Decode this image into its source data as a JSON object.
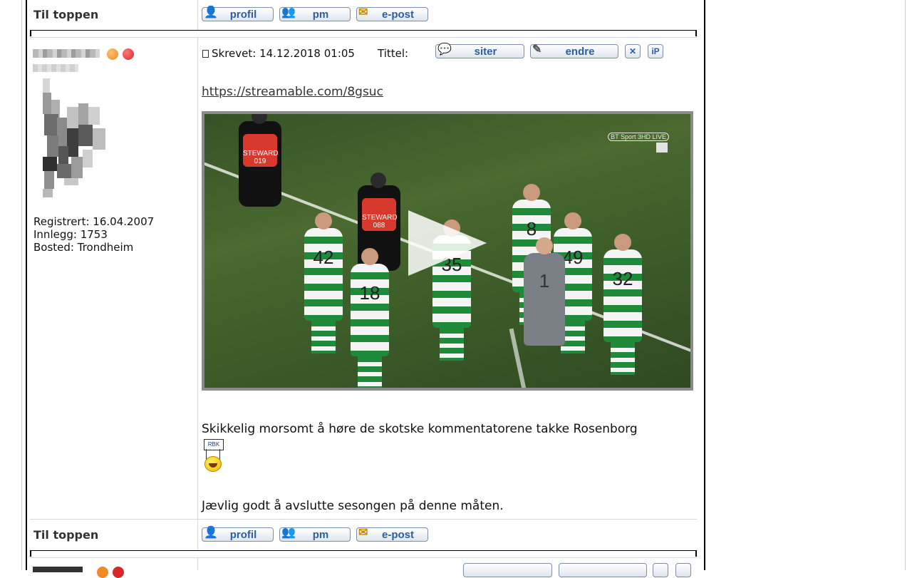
{
  "top_row": {
    "til_toppen": "Til toppen",
    "buttons": {
      "profil": "profil",
      "pm": "pm",
      "epost": "e-post"
    }
  },
  "post": {
    "author": {
      "registrert": "Registrert: 16.04.2007",
      "innlegg": "Innlegg: 1753",
      "bosted": "Bosted: Trondheim",
      "status_colors": [
        "#f08a24",
        "#d8262c"
      ]
    },
    "header": {
      "skrevet": "Skrevet: 14.12.2018 01:05",
      "tittel": "Tittel:",
      "buttons": {
        "siter": "siter",
        "endre": "endre",
        "delete": "✕",
        "ip": "iP"
      }
    },
    "link": "https://streamable.com/8gsuc",
    "video": {
      "overlay_brand": "BT Sport 3HD LIVE",
      "vest_text_1": "STEWARD 019",
      "vest_text_2": "STEWARD 088",
      "shirt_numbers": [
        "42",
        "18",
        "35",
        "8",
        "49",
        "32",
        "1"
      ]
    },
    "text_1": "Skikkelig morsomt å høre de skotske kommentatorene takke Rosenborg",
    "smiley_sign": "RBK",
    "text_2": "Jævlig godt å avslutte sesongen på denne måten."
  },
  "bottom_row": {
    "til_toppen": "Til toppen",
    "buttons": {
      "profil": "profil",
      "pm": "pm",
      "epost": "e-post"
    }
  }
}
